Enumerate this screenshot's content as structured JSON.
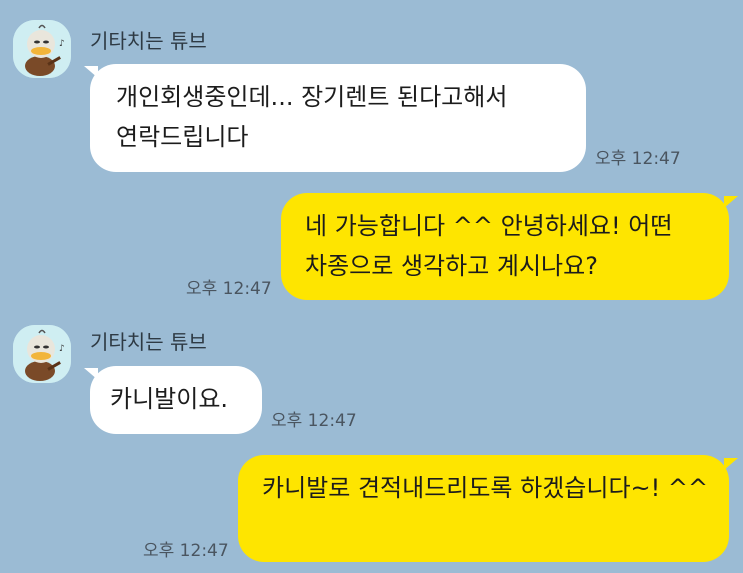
{
  "chat": {
    "messages": [
      {
        "sender": "기타치는 튜브",
        "text": "개인회생중인데... 장기렌트 된다고해서 연락드립니다",
        "time": "오후 12:47"
      },
      {
        "text": "네 가능합니다 ^^ 안녕하세요! 어떤 차종으로 생각하고 계시나요?",
        "time": "오후 12:47"
      },
      {
        "sender": "기타치는 튜브",
        "text": "카니발이요.",
        "time": "오후 12:47"
      },
      {
        "text": "카니발로 견적내드리도록 하겠습니다~! ^^",
        "time": "오후 12:47"
      }
    ]
  },
  "colors": {
    "background": "#9bbbd4",
    "incoming_bubble": "#ffffff",
    "outgoing_bubble": "#fee500",
    "avatar_bg": "#cfeef2"
  },
  "icons": {
    "avatar": "tube-duck-playing-guitar-avatar"
  }
}
